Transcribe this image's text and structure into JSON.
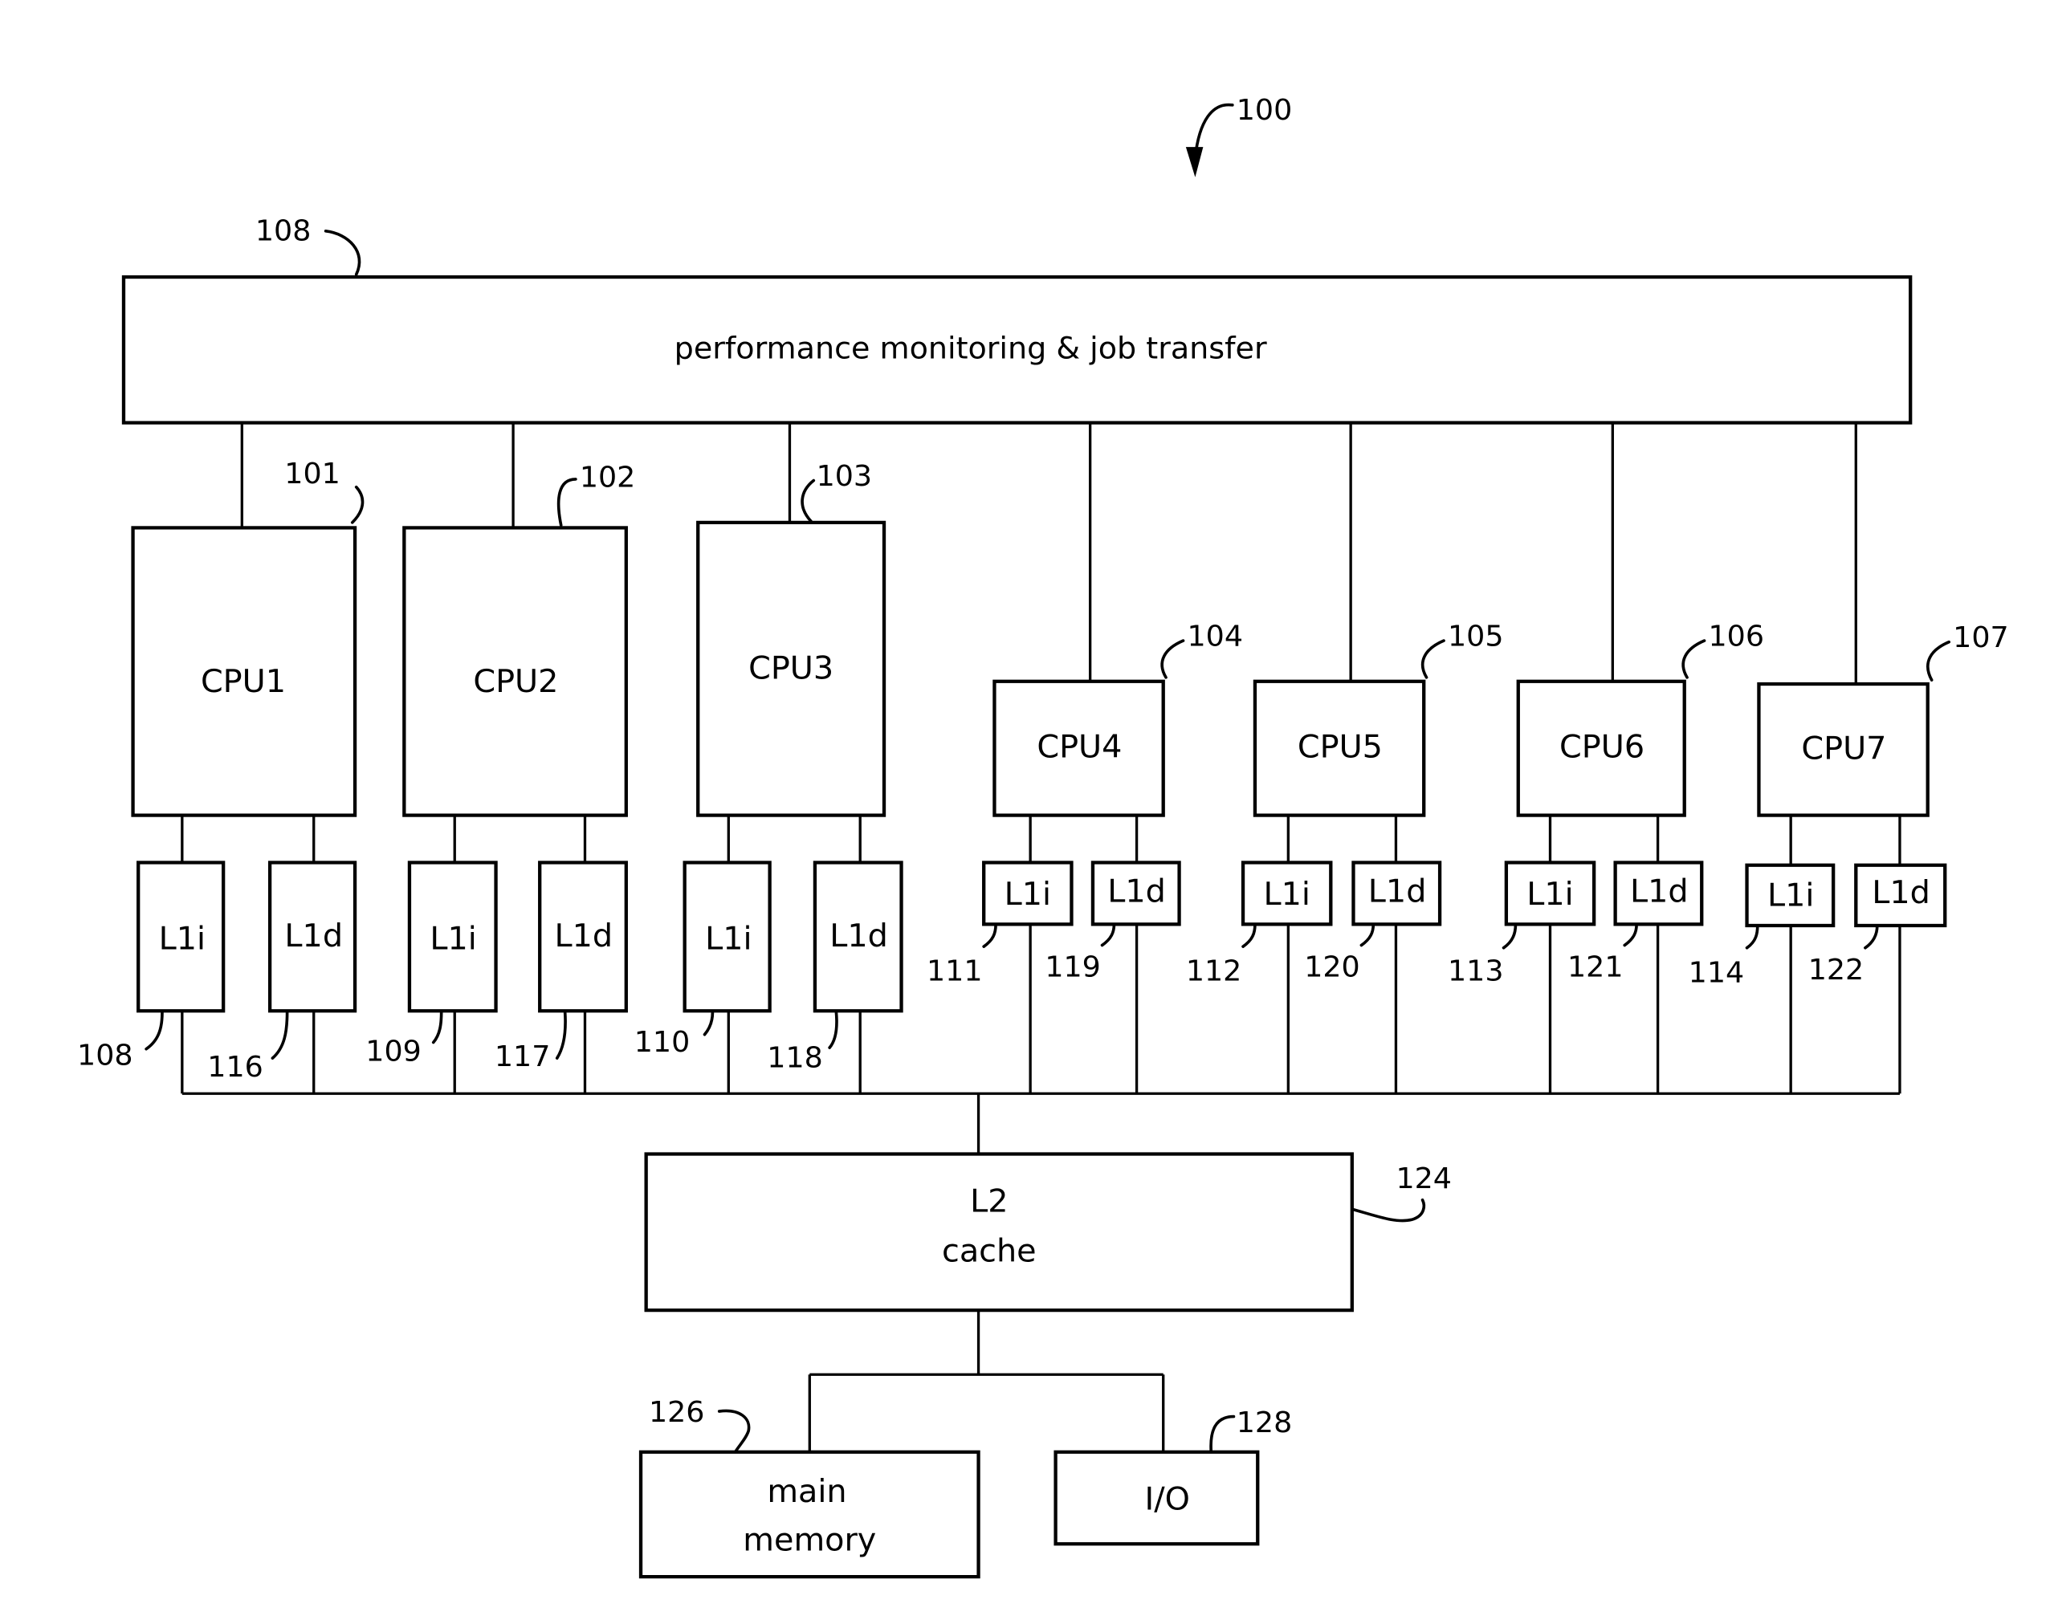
{
  "figure": {
    "ref": "100",
    "monitor": {
      "ref": "108",
      "label": "performance monitoring & job transfer"
    },
    "cpus": [
      {
        "label": "CPU1",
        "ref": "101",
        "l1i": {
          "label": "L1i",
          "ref": "108"
        },
        "l1d": {
          "label": "L1d",
          "ref": "116"
        }
      },
      {
        "label": "CPU2",
        "ref": "102",
        "l1i": {
          "label": "L1i",
          "ref": "109"
        },
        "l1d": {
          "label": "L1d",
          "ref": "117"
        }
      },
      {
        "label": "CPU3",
        "ref": "103",
        "l1i": {
          "label": "L1i",
          "ref": "110"
        },
        "l1d": {
          "label": "L1d",
          "ref": "118"
        }
      },
      {
        "label": "CPU4",
        "ref": "104",
        "l1i": {
          "label": "L1i",
          "ref": "111"
        },
        "l1d": {
          "label": "L1d",
          "ref": "119"
        }
      },
      {
        "label": "CPU5",
        "ref": "105",
        "l1i": {
          "label": "L1i",
          "ref": "112"
        },
        "l1d": {
          "label": "L1d",
          "ref": "120"
        }
      },
      {
        "label": "CPU6",
        "ref": "106",
        "l1i": {
          "label": "L1i",
          "ref": "113"
        },
        "l1d": {
          "label": "L1d",
          "ref": "121"
        }
      },
      {
        "label": "CPU7",
        "ref": "107",
        "l1i": {
          "label": "L1i",
          "ref": "114"
        },
        "l1d": {
          "label": "L1d",
          "ref": "122"
        }
      }
    ],
    "l2": {
      "line1": "L2",
      "line2": "cache",
      "ref": "124"
    },
    "memory": {
      "line1": "main",
      "line2": "memory",
      "ref": "126"
    },
    "io": {
      "label": "I/O",
      "ref": "128"
    }
  }
}
